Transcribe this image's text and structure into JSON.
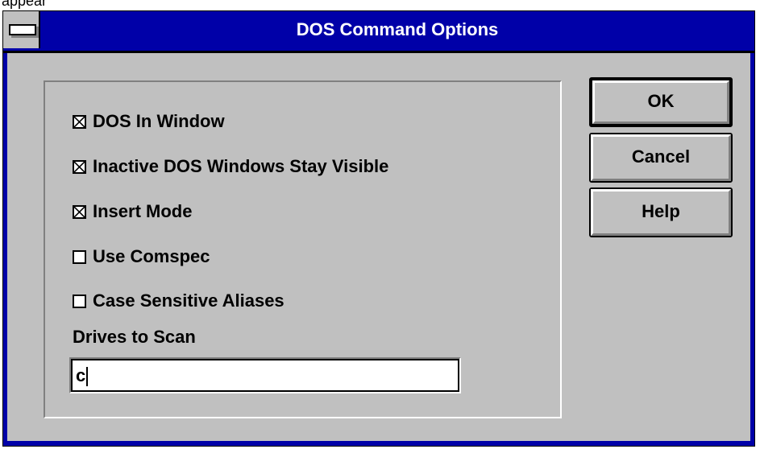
{
  "page_fragment": "appear",
  "dialog": {
    "title": "DOS Command Options",
    "options": [
      {
        "label": "DOS In Window",
        "checked": true
      },
      {
        "label": "Inactive DOS Windows Stay Visible",
        "checked": true
      },
      {
        "label": "Insert Mode",
        "checked": true
      },
      {
        "label": "Use Comspec",
        "checked": false
      },
      {
        "label": "Case Sensitive Aliases",
        "checked": false
      }
    ],
    "drives": {
      "label": "Drives to Scan",
      "value": "c"
    },
    "buttons": {
      "ok": "OK",
      "cancel": "Cancel",
      "help": "Help"
    }
  },
  "colors": {
    "title_bar": "#0000a8",
    "face": "#c0c0c0"
  }
}
